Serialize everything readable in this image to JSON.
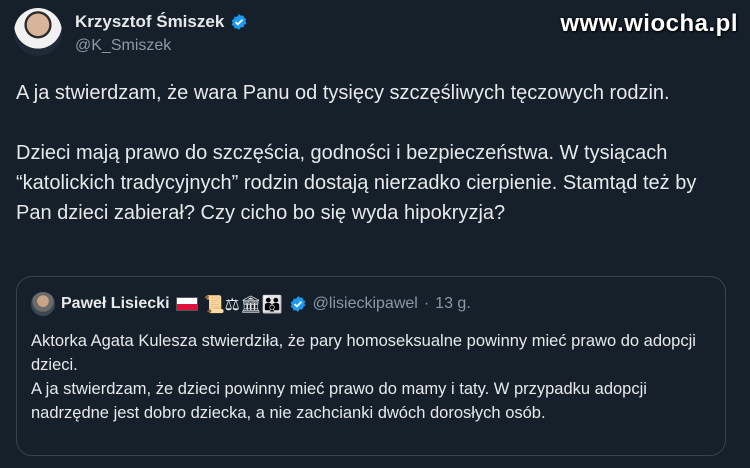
{
  "author": {
    "name": "Krzysztof Śmiszek",
    "handle": "@K_Smiszek"
  },
  "watermark": "www.wiocha.pl",
  "tweet": {
    "paragraph1": "A ja stwierdzam, że wara Panu od tysięcy szczęśliwych tęczowych rodzin.",
    "paragraph2": "Dzieci mają prawo do szczęścia, godności i bezpieczeństwa. W tysiącach “katolickich tradycyjnych” rodzin dostają nierzadko cierpienie. Stamtąd też by Pan dzieci zabierał? Czy cicho bo się wyda hipokryzja?"
  },
  "quote": {
    "name": "Paweł Lisiecki",
    "emojis": "📜⚖🏛👪",
    "handle": "@lisieckipawel",
    "separator": "·",
    "time": "13 g.",
    "line1": "Aktorka Agata Kulesza stwierdziła, że pary homoseksualne powinny mieć prawo do adopcji dzieci.",
    "line2": "A ja stwierdzam, że dzieci powinny mieć prawo do mamy i taty. W przypadku adopcji nadrzędne jest dobro dziecka, a nie zachcianki dwóch dorosłych osób."
  },
  "colors": {
    "background": "#15202b",
    "text": "#e7e9ea",
    "secondary": "#8b98a5",
    "verified": "#1d9bf0",
    "border": "#38444d"
  },
  "icons": [
    "verified-badge-icon",
    "poland-flag-icon"
  ]
}
